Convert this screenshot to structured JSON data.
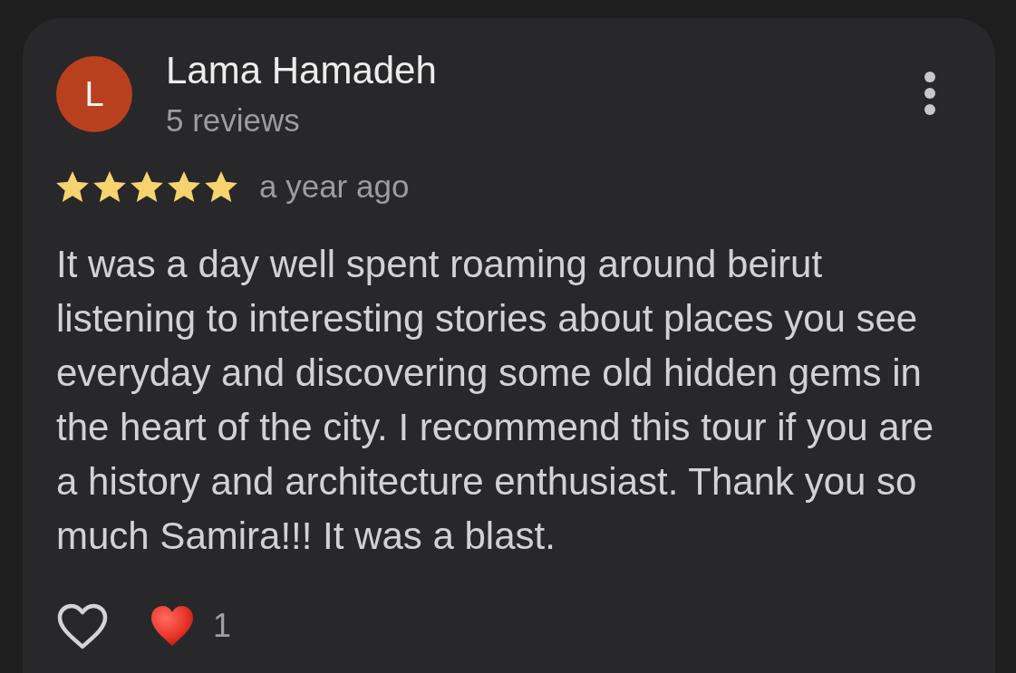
{
  "review": {
    "author": {
      "initial": "L",
      "name": "Lama Hamadeh",
      "review_count": "5 reviews"
    },
    "stars": 5,
    "time": "a year ago",
    "text": "It was a day well spent roaming around beirut listening to interesting stories about places you see everyday and discovering some old hidden gems in the heart of the city. I recommend this tour if you are a history and architecture enthusiast. Thank you so much Samira!!! It was a blast.",
    "reactions": {
      "count": "1"
    }
  }
}
